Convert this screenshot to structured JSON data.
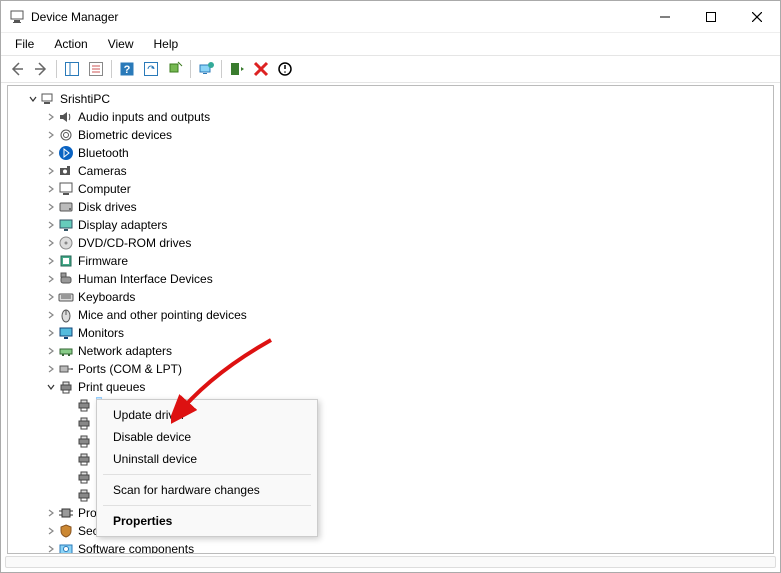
{
  "window": {
    "title": "Device Manager"
  },
  "menu": {
    "file": "File",
    "action": "Action",
    "view": "View",
    "help": "Help"
  },
  "tree": {
    "root": "SrishtiPC",
    "categories": [
      "Audio inputs and outputs",
      "Biometric devices",
      "Bluetooth",
      "Cameras",
      "Computer",
      "Disk drives",
      "Display adapters",
      "DVD/CD-ROM drives",
      "Firmware",
      "Human Interface Devices",
      "Keyboards",
      "Mice and other pointing devices",
      "Monitors",
      "Network adapters",
      "Ports (COM & LPT)",
      "Print queues"
    ],
    "selected_device": "",
    "after_print": [
      "Pro",
      "Sec",
      "Software components"
    ]
  },
  "contextmenu": {
    "update": "Update driver",
    "disable": "Disable device",
    "uninstall": "Uninstall device",
    "scan": "Scan for hardware changes",
    "properties": "Properties"
  }
}
